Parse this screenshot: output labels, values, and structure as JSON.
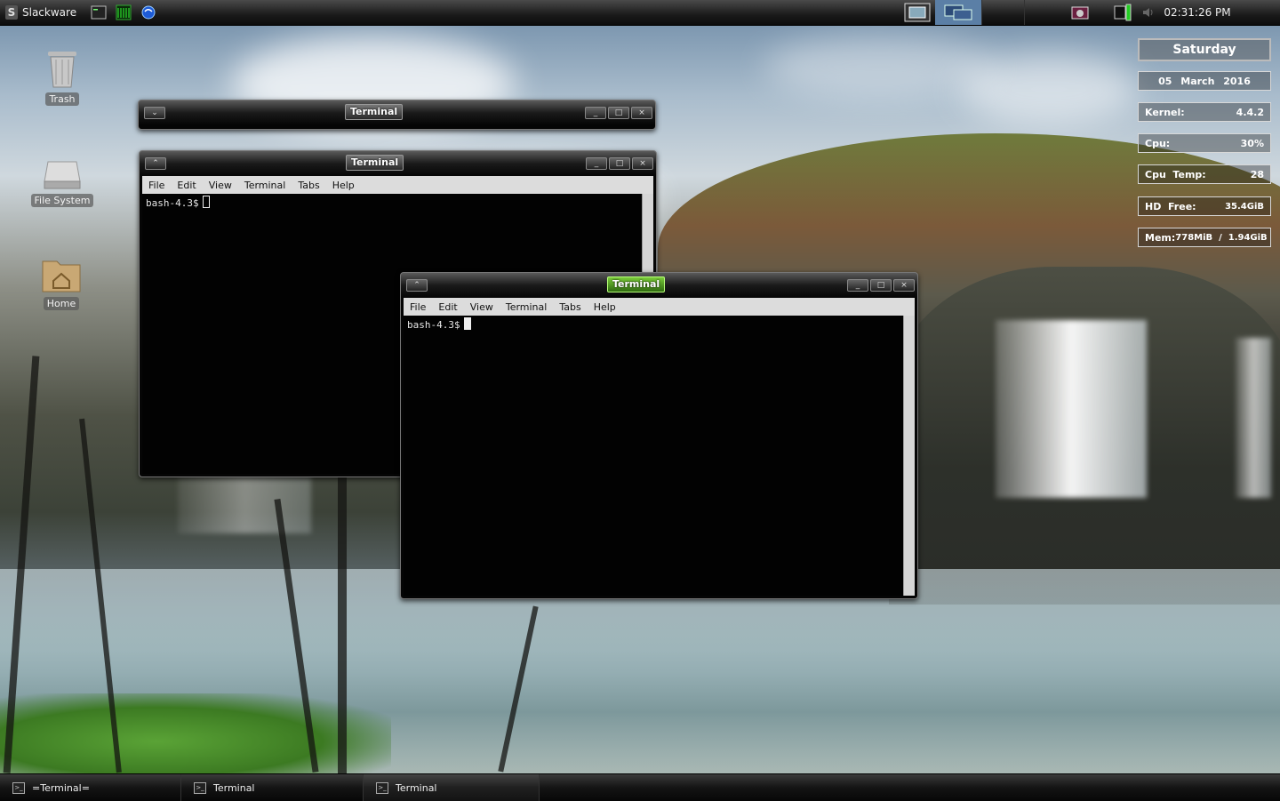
{
  "top_panel": {
    "menu_label": "Slackware",
    "clock": "02:31:26 PM"
  },
  "desktop_icons": [
    {
      "label": "Trash"
    },
    {
      "label": "File System"
    },
    {
      "label": "Home"
    }
  ],
  "conky": {
    "day": "Saturday",
    "date": "05 March 2016",
    "kernel_label": "Kernel:",
    "kernel_value": "4.4.2",
    "cpu_label": "Cpu:",
    "cpu_value": "30%",
    "cpu_temp_label": "Cpu  Temp:",
    "cpu_temp_value": "28",
    "hd_label": "HD  Free:",
    "hd_value": "35.4GiB",
    "mem_label": "Mem:",
    "mem_value": "778MiB  /  1.94GiB"
  },
  "windows": [
    {
      "title": "Terminal",
      "state": "shaded"
    },
    {
      "title": "Terminal",
      "menu": [
        "File",
        "Edit",
        "View",
        "Terminal",
        "Tabs",
        "Help"
      ],
      "prompt": "bash-4.3$"
    },
    {
      "title": "Terminal",
      "menu": [
        "File",
        "Edit",
        "View",
        "Terminal",
        "Tabs",
        "Help"
      ],
      "prompt": "bash-4.3$"
    }
  ],
  "taskbar": [
    {
      "label": "=Terminal="
    },
    {
      "label": "Terminal"
    },
    {
      "label": "Terminal"
    }
  ],
  "colors": {
    "active_title": "#5aa32a",
    "panel": "#1a1a1a"
  }
}
